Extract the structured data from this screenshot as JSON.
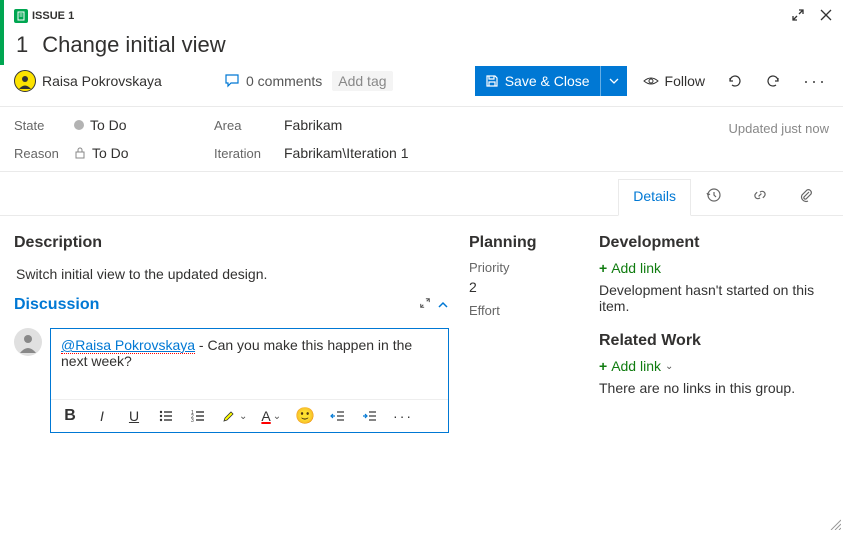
{
  "header": {
    "type_label": "ISSUE 1",
    "id": "1",
    "title": "Change initial view"
  },
  "toolbar": {
    "assignee": "Raisa Pokrovskaya",
    "comments_label": "0 comments",
    "add_tag_label": "Add tag",
    "save_label": "Save & Close",
    "follow_label": "Follow"
  },
  "fields": {
    "state_label": "State",
    "state_value": "To Do",
    "reason_label": "Reason",
    "reason_value": "To Do",
    "area_label": "Area",
    "area_value": "Fabrikam",
    "iteration_label": "Iteration",
    "iteration_value": "Fabrikam\\Iteration 1",
    "updated_label": "Updated just now"
  },
  "tabs": {
    "details": "Details"
  },
  "description": {
    "heading": "Description",
    "text": "Switch initial view to the updated design."
  },
  "discussion": {
    "heading": "Discussion",
    "mention": "@Raisa Pokrovskaya",
    "text": " - Can you make this happen in the next week?"
  },
  "planning": {
    "heading": "Planning",
    "priority_label": "Priority",
    "priority_value": "2",
    "effort_label": "Effort"
  },
  "development": {
    "heading": "Development",
    "add_link": "Add link",
    "empty_text": "Development hasn't started on this item."
  },
  "related": {
    "heading": "Related Work",
    "add_link": "Add link",
    "empty_text": "There are no links in this group."
  }
}
